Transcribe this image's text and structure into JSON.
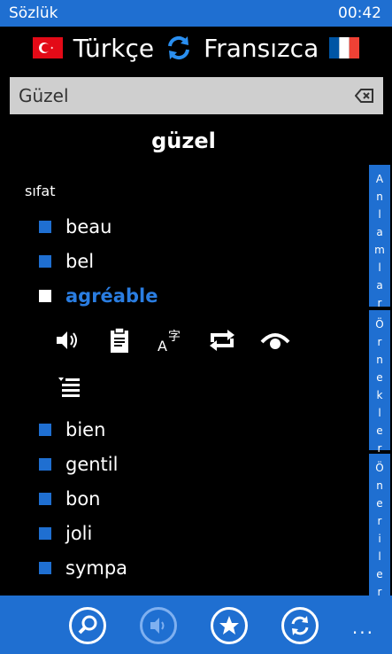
{
  "status": {
    "app_title": "Sözlük",
    "time": "00:42"
  },
  "lang": {
    "source": "Türkçe",
    "target": "Fransızca",
    "source_flag_icon": "turkey-flag-icon",
    "target_flag_icon": "france-flag-icon"
  },
  "search": {
    "value": "Güzel"
  },
  "entry": {
    "headword": "güzel",
    "pos": "sıfat",
    "items_top": [
      {
        "label": "beau"
      },
      {
        "label": "bel"
      }
    ],
    "selected": {
      "label": "agréable"
    },
    "items_bottom": [
      {
        "label": "bien"
      },
      {
        "label": "gentil"
      },
      {
        "label": "bon"
      },
      {
        "label": "joli"
      },
      {
        "label": "sympa"
      }
    ]
  },
  "sidetabs": [
    {
      "label": "Anlamlar"
    },
    {
      "label": "Örnekler"
    },
    {
      "label": "Öneriler"
    }
  ],
  "appbar": {
    "more": "..."
  },
  "colors": {
    "accent": "#1f6fd1",
    "selected_text": "#2a7de1"
  }
}
